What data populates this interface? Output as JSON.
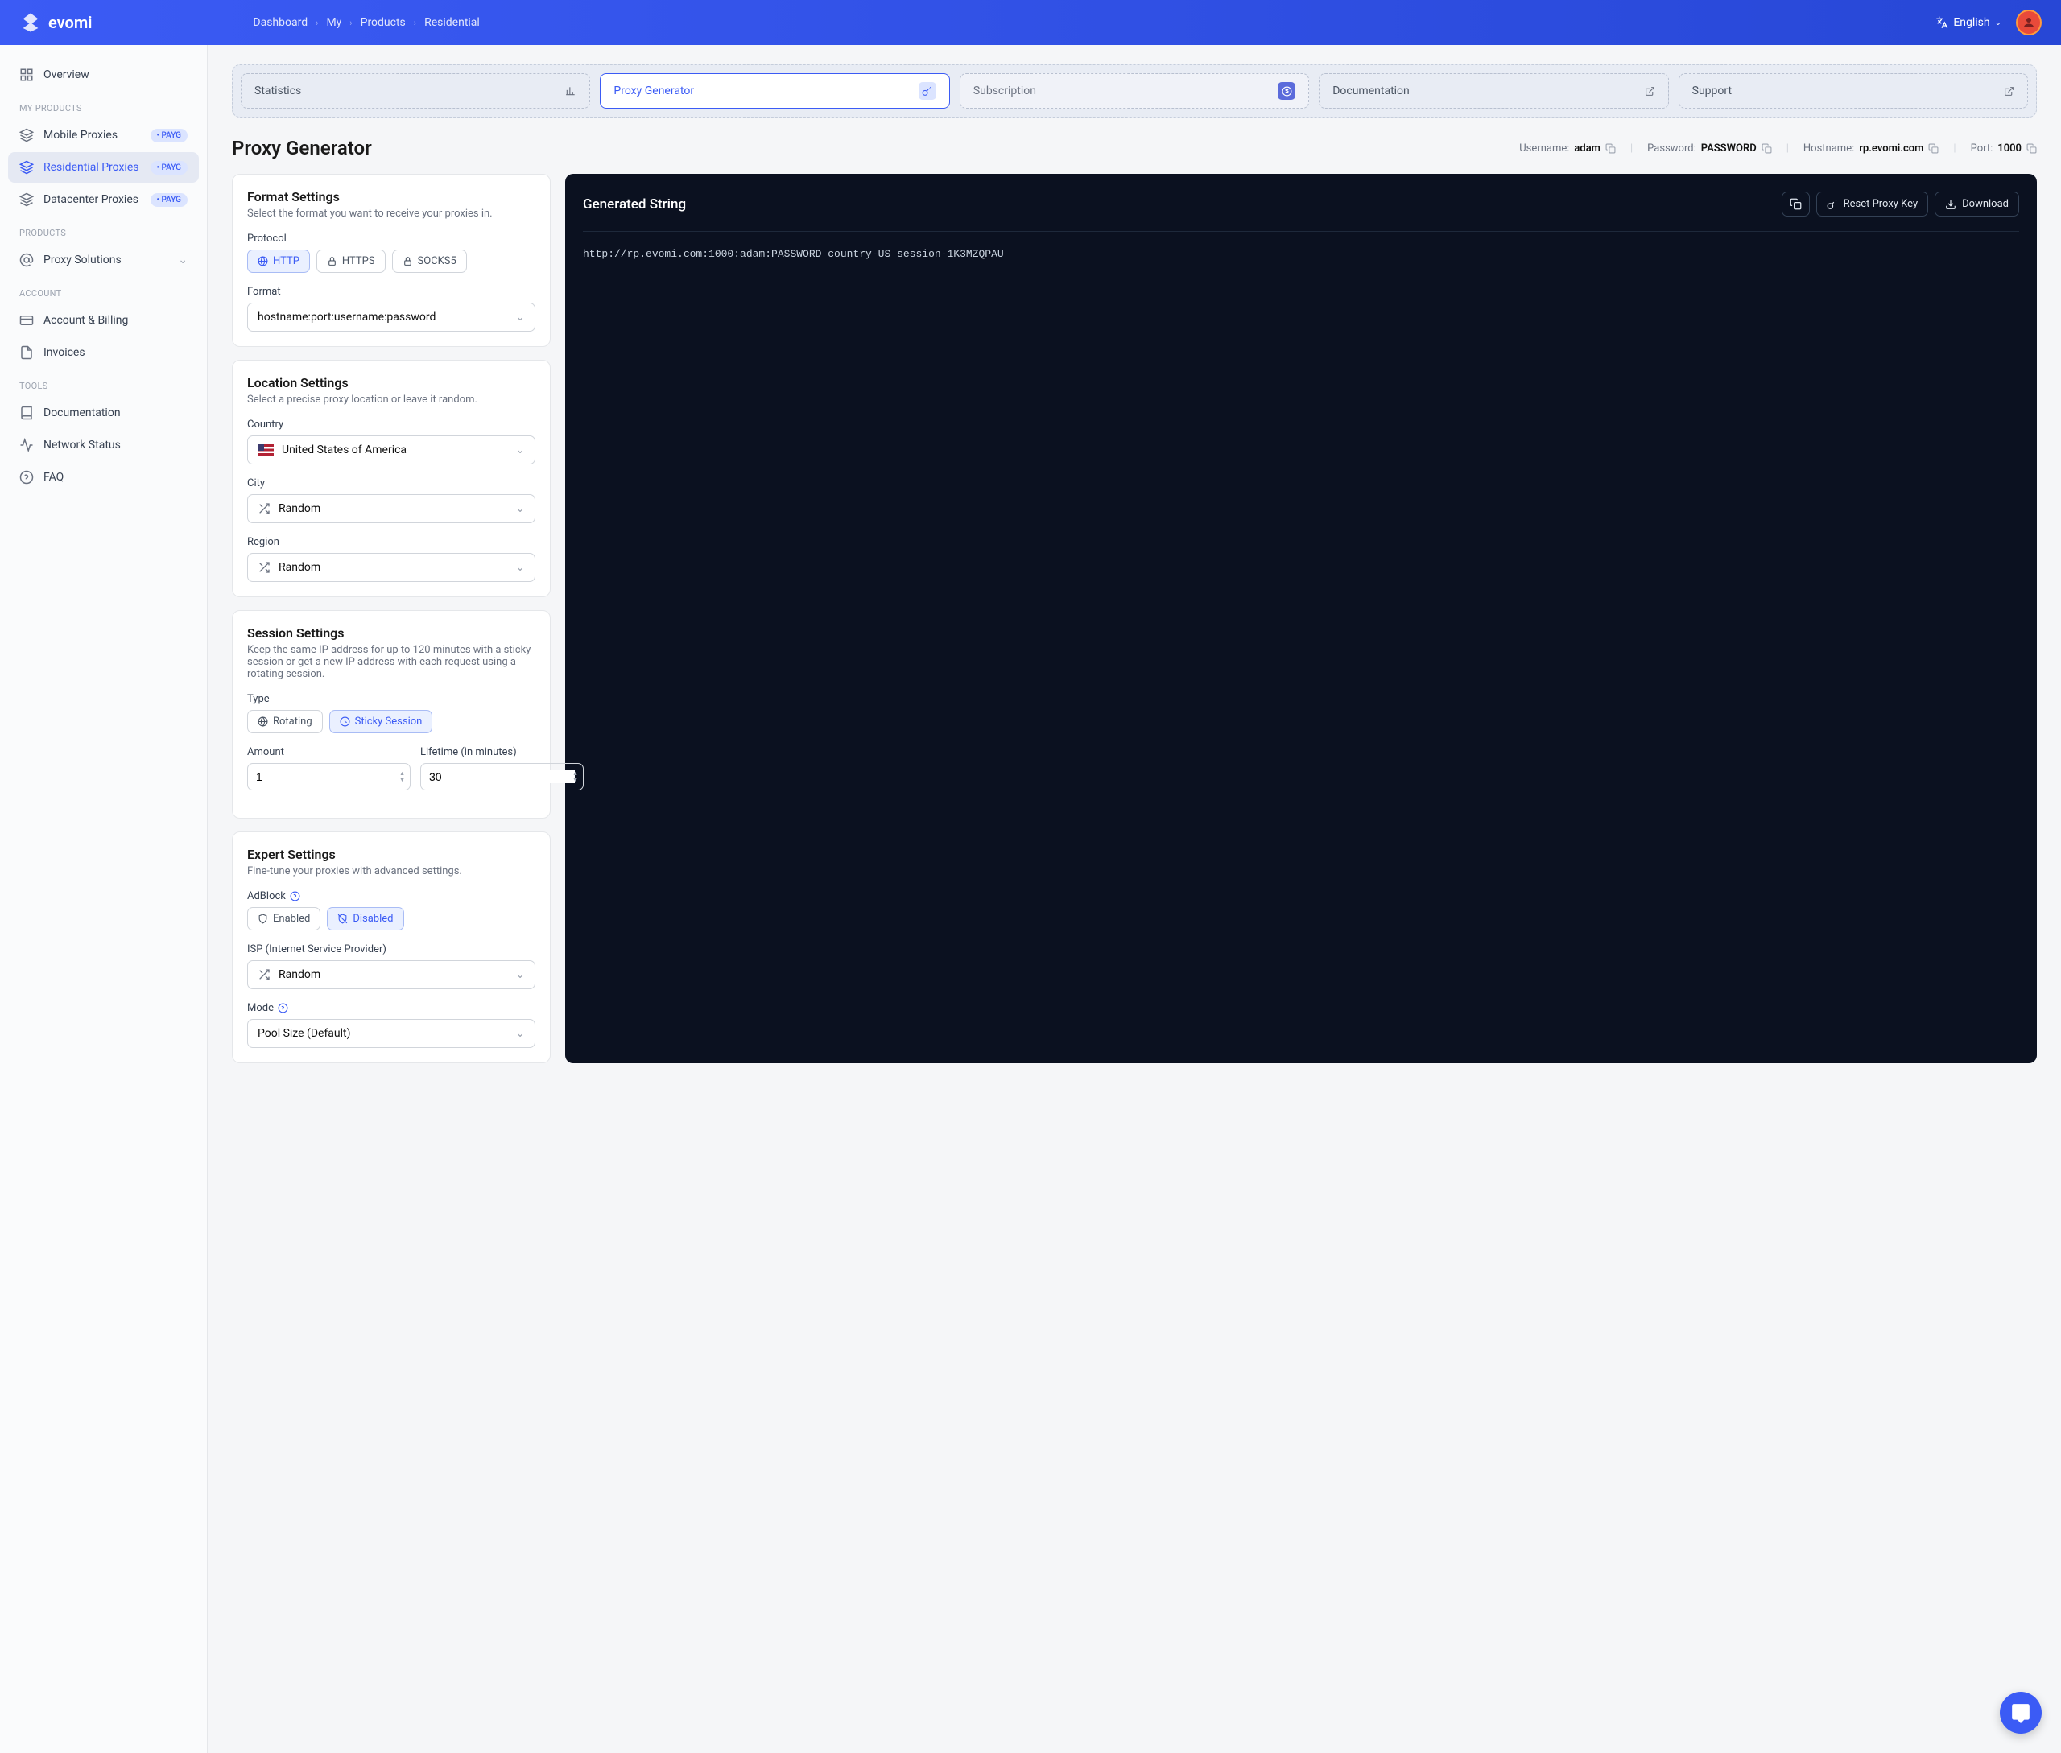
{
  "header": {
    "brand": "evomi",
    "breadcrumb": [
      "Dashboard",
      "My",
      "Products",
      "Residential"
    ],
    "language": "English"
  },
  "sidebar": {
    "overview": "Overview",
    "sections": {
      "my_products": "MY PRODUCTS",
      "products": "Products",
      "account": "Account",
      "tools": "Tools"
    },
    "my_products": [
      {
        "label": "Mobile Proxies",
        "badge": "PAYG"
      },
      {
        "label": "Residential Proxies",
        "badge": "PAYG",
        "active": true
      },
      {
        "label": "Datacenter Proxies",
        "badge": "PAYG"
      }
    ],
    "products": [
      {
        "label": "Proxy Solutions"
      }
    ],
    "account": [
      {
        "label": "Account & Billing"
      },
      {
        "label": "Invoices"
      }
    ],
    "tools": [
      {
        "label": "Documentation"
      },
      {
        "label": "Network Status"
      },
      {
        "label": "FAQ"
      }
    ]
  },
  "tabs": [
    {
      "label": "Statistics"
    },
    {
      "label": "Proxy Generator",
      "active": true
    },
    {
      "label": "Subscription",
      "sub": true
    },
    {
      "label": "Documentation"
    },
    {
      "label": "Support"
    }
  ],
  "page": {
    "title": "Proxy Generator",
    "creds": {
      "username_label": "Username:",
      "username": "adam",
      "password_label": "Password:",
      "password": "PASSWORD",
      "hostname_label": "Hostname:",
      "hostname": "rp.evomi.com",
      "port_label": "Port:",
      "port": "1000"
    }
  },
  "format": {
    "title": "Format Settings",
    "desc": "Select the format you want to receive your proxies in.",
    "protocol_label": "Protocol",
    "protocols": [
      {
        "label": "HTTP",
        "active": true
      },
      {
        "label": "HTTPS"
      },
      {
        "label": "SOCKS5"
      }
    ],
    "format_label": "Format",
    "format_value": "hostname:port:username:password"
  },
  "location": {
    "title": "Location Settings",
    "desc": "Select a precise proxy location or leave it random.",
    "country_label": "Country",
    "country_value": "United States of America",
    "city_label": "City",
    "city_value": "Random",
    "region_label": "Region",
    "region_value": "Random"
  },
  "session": {
    "title": "Session Settings",
    "desc": "Keep the same IP address for up to 120 minutes with a sticky session or get a new IP address with each request using a rotating session.",
    "type_label": "Type",
    "types": [
      {
        "label": "Rotating"
      },
      {
        "label": "Sticky Session",
        "active": true
      }
    ],
    "amount_label": "Amount",
    "amount_value": "1",
    "lifetime_label": "Lifetime (in minutes)",
    "lifetime_value": "30"
  },
  "expert": {
    "title": "Expert Settings",
    "desc": "Fine-tune your proxies with advanced settings.",
    "adblock_label": "AdBlock",
    "adblock": [
      {
        "label": "Enabled"
      },
      {
        "label": "Disabled",
        "active": true
      }
    ],
    "isp_label": "ISP (Internet Service Provider)",
    "isp_value": "Random",
    "mode_label": "Mode",
    "mode_value": "Pool Size (Default)"
  },
  "generated": {
    "title": "Generated String",
    "reset": "Reset Proxy Key",
    "download": "Download",
    "code": "http://rp.evomi.com:1000:adam:PASSWORD_country-US_session-1K3MZQPAU"
  }
}
